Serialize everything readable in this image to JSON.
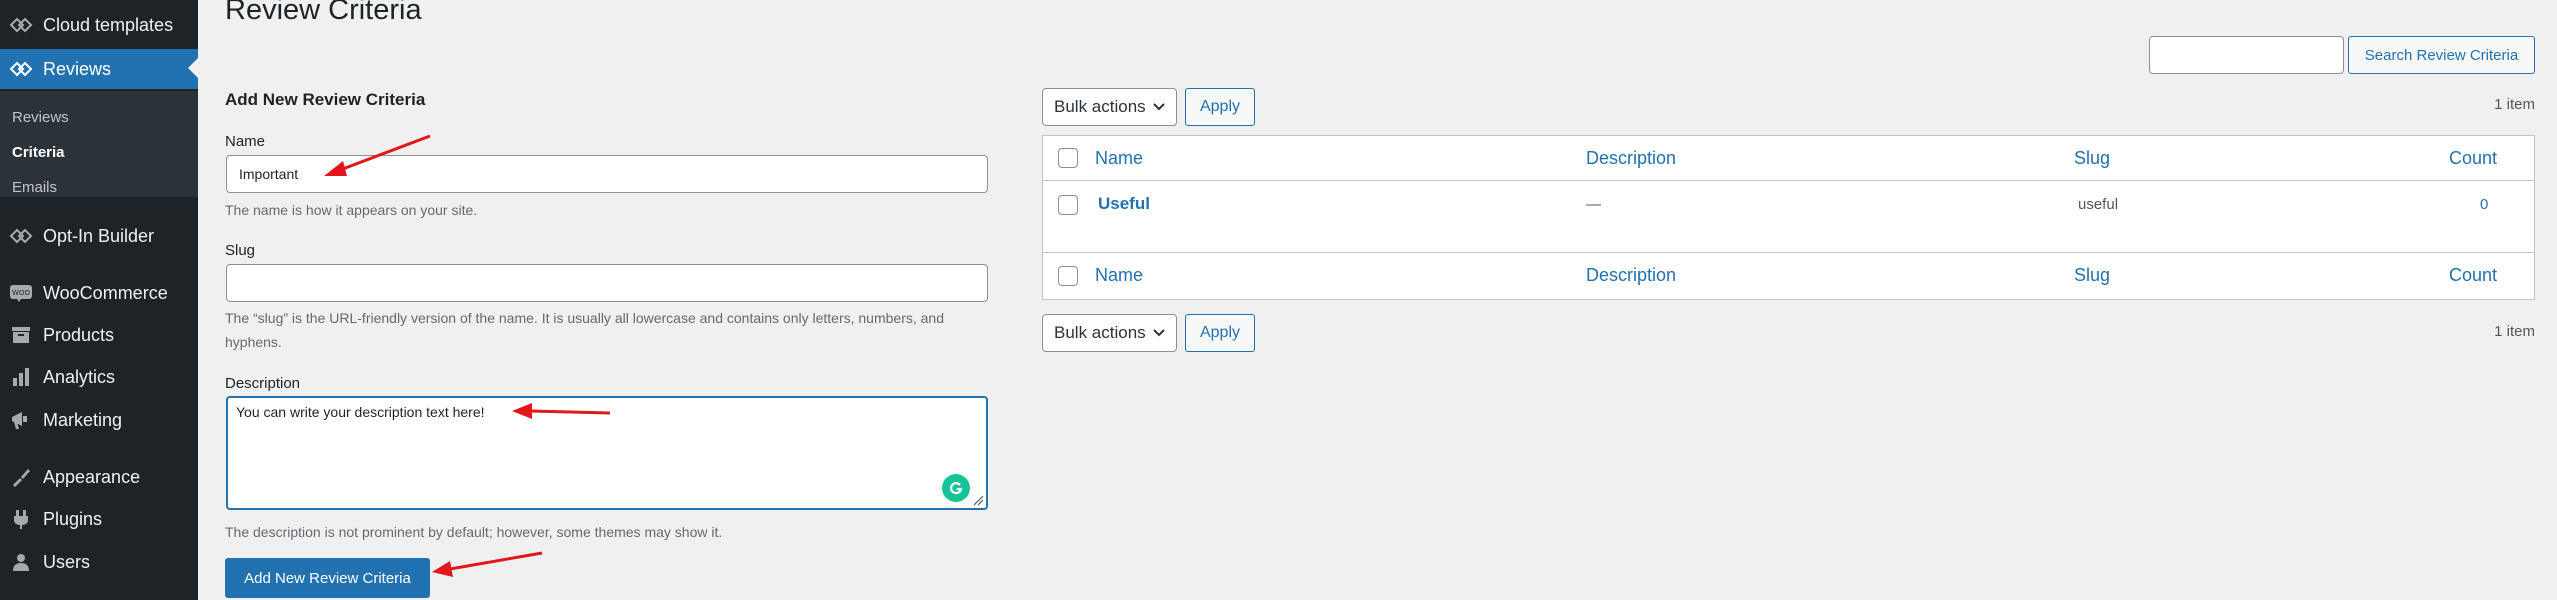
{
  "sidebar": {
    "items": [
      {
        "label": "Cloud templates",
        "icon": "cloud-templates-icon"
      },
      {
        "label": "Reviews",
        "icon": "reviews-icon",
        "current": true
      },
      {
        "label": "Opt-In Builder",
        "icon": "opt-in-builder-icon"
      },
      {
        "label": "WooCommerce",
        "icon": "woocommerce-icon"
      },
      {
        "label": "Products",
        "icon": "products-icon"
      },
      {
        "label": "Analytics",
        "icon": "analytics-icon"
      },
      {
        "label": "Marketing",
        "icon": "marketing-icon"
      },
      {
        "label": "Appearance",
        "icon": "appearance-icon"
      },
      {
        "label": "Plugins",
        "icon": "plugins-icon"
      },
      {
        "label": "Users",
        "icon": "users-icon"
      }
    ],
    "submenu": [
      {
        "label": "Reviews",
        "active": false
      },
      {
        "label": "Criteria",
        "active": true
      },
      {
        "label": "Emails",
        "active": false
      }
    ]
  },
  "page": {
    "title": "Review Criteria"
  },
  "form": {
    "heading": "Add New Review Criteria",
    "name_label": "Name",
    "name_value": "Important",
    "name_help": "The name is how it appears on your site.",
    "slug_label": "Slug",
    "slug_value": "",
    "slug_help": "The “slug” is the URL-friendly version of the name. It is usually all lowercase and contains only letters, numbers, and hyphens.",
    "description_label": "Description",
    "description_value": "You can write your description text here!",
    "description_help": "The description is not prominent by default; however, some themes may show it.",
    "submit_label": "Add New Review Criteria"
  },
  "search": {
    "value": "",
    "button_label": "Search Review Criteria"
  },
  "bulk": {
    "selected": "Bulk actions",
    "apply_label": "Apply",
    "item_count": "1 item"
  },
  "table": {
    "headers": {
      "name": "Name",
      "description": "Description",
      "slug": "Slug",
      "count": "Count"
    },
    "rows": [
      {
        "name": "Useful",
        "description": "—",
        "slug": "useful",
        "count": "0"
      }
    ]
  },
  "colors": {
    "sidebar_bg": "#1d2327",
    "accent": "#2271b1",
    "page_bg": "#f0f0f1",
    "annotation_arrow": "#e3171b",
    "grammarly": "#15c39a"
  }
}
